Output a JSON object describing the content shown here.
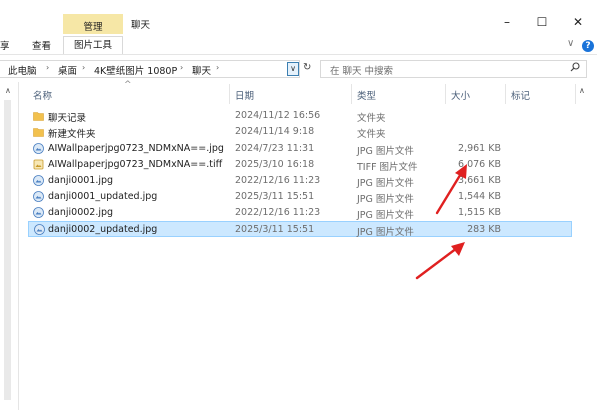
{
  "window": {
    "context_tab": "管理",
    "title": "聊天",
    "minimize_icon": "minimize-icon",
    "maximize_icon": "maximize-icon",
    "close_icon": "close-icon"
  },
  "ribbon": {
    "tabs": [
      "享",
      "查看",
      "图片工具"
    ],
    "help_icon": "help-icon",
    "help_label": "?"
  },
  "address": {
    "crumbs": [
      "此电脑",
      "桌面",
      "4K壁纸图片 1080P",
      "聊天"
    ],
    "search_placeholder": "在 聊天 中搜索"
  },
  "columns": {
    "name": "名称",
    "date": "日期",
    "type": "类型",
    "size": "大小",
    "tags": "标记"
  },
  "files": [
    {
      "name": "聊天记录",
      "date": "2024/11/12 16:56",
      "type": "文件夹",
      "size": "",
      "icon": "folder-icon"
    },
    {
      "name": "新建文件夹",
      "date": "2024/11/14 9:18",
      "type": "文件夹",
      "size": "",
      "icon": "folder-icon"
    },
    {
      "name": "AIWallpaperjpg0723_NDMxNA==.jpg",
      "date": "2024/7/23 11:31",
      "type": "JPG 图片文件",
      "size": "2,961 KB",
      "icon": "jpg-image-icon"
    },
    {
      "name": "AIWallpaperjpg0723_NDMxNA==.tiff",
      "date": "2025/3/10 16:18",
      "type": "TIFF 图片文件",
      "size": "6,076 KB",
      "icon": "tiff-image-icon"
    },
    {
      "name": "danji0001.jpg",
      "date": "2022/12/16 11:23",
      "type": "JPG 图片文件",
      "size": "3,661 KB",
      "icon": "jpg-image-icon"
    },
    {
      "name": "danji0001_updated.jpg",
      "date": "2025/3/11 15:51",
      "type": "JPG 图片文件",
      "size": "1,544 KB",
      "icon": "jpg-image-icon"
    },
    {
      "name": "danji0002.jpg",
      "date": "2022/12/16 11:23",
      "type": "JPG 图片文件",
      "size": "1,515 KB",
      "icon": "jpg-image-icon"
    },
    {
      "name": "danji0002_updated.jpg",
      "date": "2025/3/11 15:51",
      "type": "JPG 图片文件",
      "size": "283 KB",
      "icon": "jpg-image-icon",
      "selected": true
    }
  ],
  "colors": {
    "selection": "#cce8ff",
    "context_tab": "#f6e7a6",
    "annotation": "#e02020",
    "folder": "#f2c14e"
  }
}
